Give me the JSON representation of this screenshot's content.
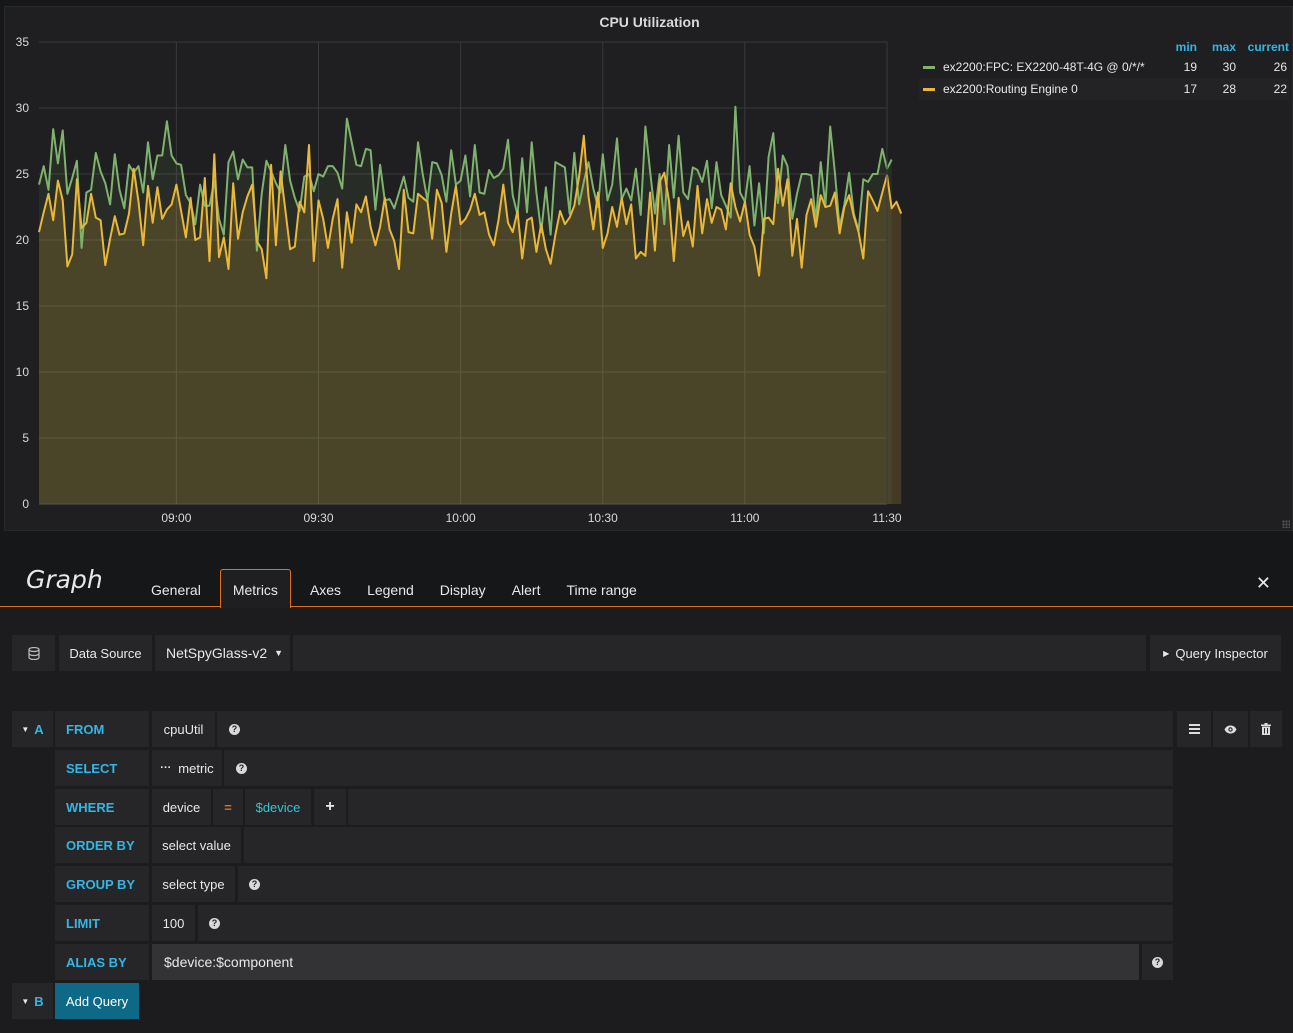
{
  "panel": {
    "title": "CPU Utilization",
    "legend": {
      "columns": [
        "min",
        "max",
        "current"
      ],
      "series": [
        {
          "name": "ex2200:FPC: EX2200-48T-4G @ 0/*/*",
          "color": "#7eb26d",
          "min": "19",
          "max": "30",
          "current": "26"
        },
        {
          "name": "ex2200:Routing Engine 0",
          "color": "#eab839",
          "min": "17",
          "max": "28",
          "current": "22"
        }
      ]
    }
  },
  "chart_data": {
    "type": "line",
    "title": "CPU Utilization",
    "xlabel": "",
    "ylabel": "",
    "ylim": [
      0,
      35
    ],
    "yticks": [
      "0",
      "5",
      "10",
      "15",
      "20",
      "25",
      "30",
      "35"
    ],
    "xticks": [
      "09:00",
      "09:30",
      "10:00",
      "10:30",
      "11:00",
      "11:30"
    ],
    "xlim_minutes": [
      511,
      690
    ],
    "x_start_minute": 511,
    "x_step_minutes": 1,
    "fill": true,
    "grid": true,
    "legend_position": "right",
    "series": [
      {
        "name": "ex2200:FPC: EX2200-48T-4G @ 0/*/*",
        "color": "#7eb26d",
        "values": [
          24.2,
          25.6,
          23.8,
          28.4,
          25.8,
          28.3,
          23.5,
          24.7,
          26.0,
          19.4,
          23.6,
          23.8,
          26.6,
          25.2,
          24.3,
          22.7,
          26.5,
          23.8,
          22.4,
          25.7,
          25.1,
          25.6,
          23.6,
          27.4,
          24.6,
          26.4,
          26.4,
          29.0,
          26.4,
          25.8,
          25.7,
          23.4,
          22.8,
          21.2,
          24.2,
          22.6,
          22.6,
          24.5,
          21.6,
          20.4,
          25.9,
          26.7,
          24.6,
          26.1,
          25.5,
          25.5,
          19.2,
          23.5,
          26.0,
          25.2,
          24.3,
          23.6,
          27.2,
          24.5,
          23.2,
          22.2,
          24.8,
          25.0,
          23.7,
          25.0,
          24.8,
          25.6,
          25.6,
          25.1,
          23.9,
          29.2,
          27.4,
          25.7,
          25.6,
          26.9,
          26.8,
          22.3,
          25.7,
          23.0,
          23.1,
          22.4,
          23.6,
          24.8,
          23.2,
          22.9,
          27.4,
          25.0,
          23.0,
          25.9,
          25.8,
          24.9,
          22.9,
          26.8,
          24.2,
          24.5,
          26.4,
          23.3,
          27.2,
          23.6,
          23.5,
          25.3,
          24.7,
          24.9,
          25.4,
          27.6,
          23.4,
          21.9,
          26.2,
          22.1,
          27.4,
          23.6,
          20.6,
          24.0,
          20.4,
          25.9,
          25.7,
          25.5,
          22.0,
          26.6,
          22.7,
          24.4,
          25.9,
          23.9,
          22.5,
          26.5,
          23.0,
          24.2,
          27.7,
          23.1,
          23.9,
          23.0,
          25.4,
          21.9,
          28.6,
          25.2,
          22.0,
          25.0,
          21.2,
          27.2,
          23.2,
          27.9,
          23.6,
          23.1,
          25.5,
          25.3,
          24.4,
          26.0,
          22.4,
          25.9,
          23.4,
          22.6,
          21.7,
          30.1,
          23.6,
          22.9,
          25.6,
          21.1,
          24.3,
          20.5,
          26.3,
          28.1,
          22.8,
          26.4,
          25.6,
          21.6,
          23.5,
          25.0,
          25.0,
          24.9,
          21.5,
          25.9,
          22.6,
          28.6,
          25.1,
          21.0,
          22.7,
          25.1,
          22.0,
          20.7,
          24.6,
          24.4,
          25.0,
          25.0,
          26.9,
          25.4,
          26.1
        ]
      },
      {
        "name": "ex2200:Routing Engine 0",
        "color": "#eab839",
        "values": [
          20.6,
          22.1,
          23.5,
          21.5,
          24.5,
          23.0,
          18.0,
          18.9,
          24.6,
          20.9,
          21.3,
          23.5,
          21.7,
          21.5,
          18.1,
          20.1,
          21.8,
          20.4,
          20.5,
          22.0,
          25.4,
          22.9,
          19.6,
          24.1,
          21.3,
          24.0,
          21.6,
          22.3,
          22.7,
          24.2,
          22.2,
          20.2,
          23.2,
          20.0,
          20.2,
          24.7,
          18.4,
          26.5,
          18.7,
          20.2,
          17.8,
          24.3,
          20.1,
          22.1,
          23.3,
          24.2,
          19.9,
          19.3,
          17.1,
          25.7,
          19.6,
          25.2,
          22.3,
          19.3,
          19.5,
          22.9,
          22.1,
          27.2,
          18.4,
          23.0,
          21.6,
          19.4,
          21.6,
          23.1,
          17.9,
          22.1,
          19.8,
          22.7,
          22.1,
          23.3,
          21.0,
          19.6,
          21.0,
          23.2,
          20.8,
          19.9,
          17.8,
          23.8,
          20.6,
          20.5,
          23.5,
          23.2,
          22.9,
          20.1,
          23.8,
          22.8,
          19.1,
          22.0,
          24.1,
          21.2,
          21.6,
          22.3,
          23.5,
          21.9,
          22.1,
          20.4,
          19.6,
          21.5,
          24.2,
          21.3,
          20.6,
          22.2,
          18.6,
          21.5,
          21.7,
          19.1,
          21.2,
          19.3,
          18.2,
          20.4,
          22.2,
          21.2,
          21.7,
          22.6,
          24.8,
          27.9,
          23.3,
          20.8,
          23.6,
          19.4,
          20.5,
          22.5,
          21.0,
          23.2,
          21.2,
          22.7,
          18.6,
          19.1,
          18.8,
          23.6,
          19.2,
          24.4,
          25.1,
          22.9,
          18.4,
          23.2,
          20.3,
          21.4,
          19.5,
          24.1,
          20.5,
          23.1,
          21.3,
          22.5,
          22.3,
          20.8,
          24.3,
          22.5,
          21.4,
          22.9,
          20.4,
          19.5,
          17.3,
          21.6,
          21.7,
          21.2,
          25.4,
          22.6,
          24.6,
          18.8,
          21.6,
          17.9,
          21.9,
          23.1,
          21.0,
          23.4,
          22.5,
          22.6,
          23.6,
          20.5,
          22.5,
          23.4,
          21.8,
          20.6,
          18.6,
          23.7,
          23.0,
          22.2,
          23.6,
          24.9,
          22.4,
          22.9,
          22.0
        ]
      }
    ]
  },
  "editor": {
    "title": "Graph",
    "tabs": [
      "General",
      "Metrics",
      "Axes",
      "Legend",
      "Display",
      "Alert",
      "Time range"
    ],
    "active_tab": "Metrics",
    "close_icon": "✕",
    "datasource_label": "Data Source",
    "datasource_value": "NetSpyGlass-v2",
    "query_inspector": "Query Inspector",
    "query_a": {
      "ref": "A",
      "from_kw": "FROM",
      "from_val": "cpuUtil",
      "select_kw": "SELECT",
      "select_val": "metric",
      "where_kw": "WHERE",
      "where_key": "device",
      "where_op": "=",
      "where_val": "$device",
      "where_add": "+",
      "order_kw": "ORDER BY",
      "order_val": "select value",
      "group_kw": "GROUP BY",
      "group_val": "select type",
      "limit_kw": "LIMIT",
      "limit_val": "100",
      "alias_kw": "ALIAS BY",
      "alias_val": "$device:$component",
      "help": "?"
    },
    "query_b": {
      "ref": "B",
      "add_label": "Add Query"
    }
  }
}
